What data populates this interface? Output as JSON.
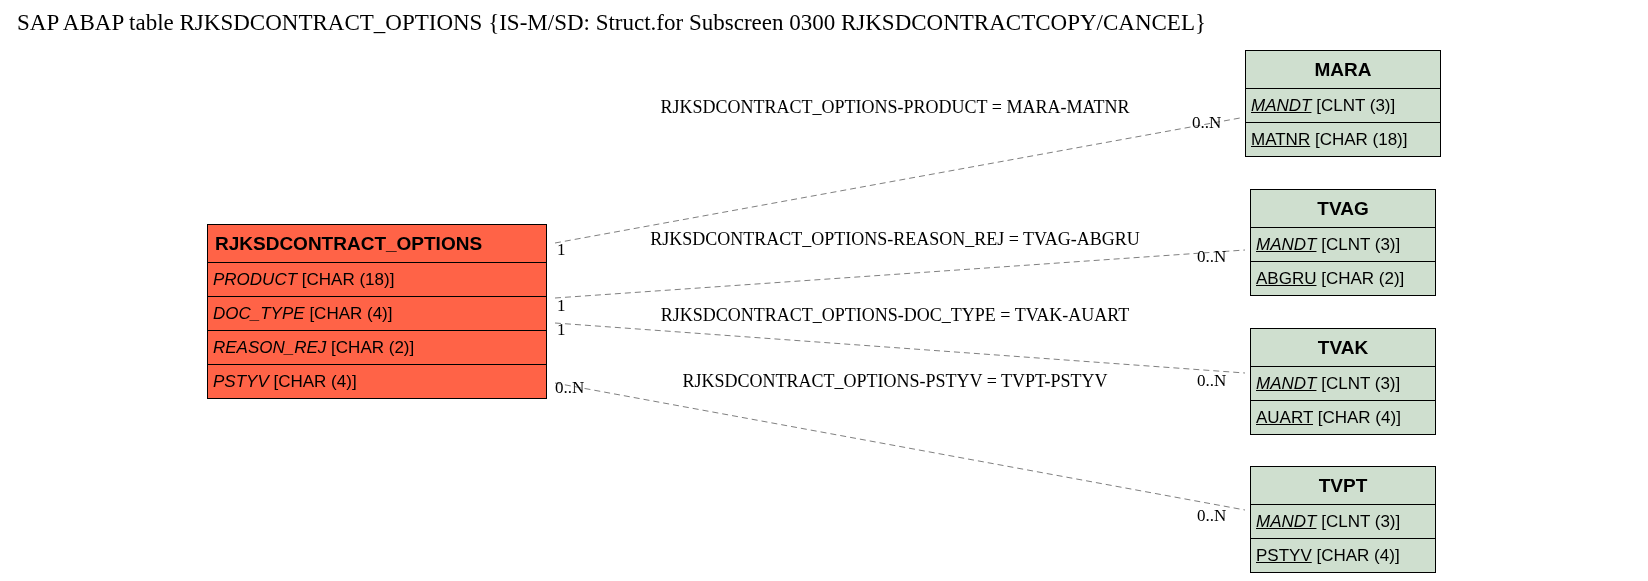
{
  "title": "SAP ABAP table RJKSDCONTRACT_OPTIONS {IS-M/SD: Struct.for Subscreen 0300 RJKSDCONTRACTCOPY/CANCEL}",
  "main_table": {
    "name": "RJKSDCONTRACT_OPTIONS",
    "fields": [
      {
        "name": "PRODUCT",
        "type": "[CHAR (18)]",
        "key": false,
        "italic": true
      },
      {
        "name": "DOC_TYPE",
        "type": "[CHAR (4)]",
        "key": false,
        "italic": true
      },
      {
        "name": "REASON_REJ",
        "type": "[CHAR (2)]",
        "key": false,
        "italic": true
      },
      {
        "name": "PSTYV",
        "type": "[CHAR (4)]",
        "key": false,
        "italic": true
      }
    ]
  },
  "related_tables": [
    {
      "name": "MARA",
      "fields": [
        {
          "name": "MANDT",
          "type": "[CLNT (3)]",
          "key": true,
          "italic": true
        },
        {
          "name": "MATNR",
          "type": "[CHAR (18)]",
          "key": true,
          "italic": false
        }
      ]
    },
    {
      "name": "TVAG",
      "fields": [
        {
          "name": "MANDT",
          "type": "[CLNT (3)]",
          "key": true,
          "italic": true
        },
        {
          "name": "ABGRU",
          "type": "[CHAR (2)]",
          "key": true,
          "italic": false
        }
      ]
    },
    {
      "name": "TVAK",
      "fields": [
        {
          "name": "MANDT",
          "type": "[CLNT (3)]",
          "key": true,
          "italic": true
        },
        {
          "name": "AUART",
          "type": "[CHAR (4)]",
          "key": true,
          "italic": false
        }
      ]
    },
    {
      "name": "TVPT",
      "fields": [
        {
          "name": "MANDT",
          "type": "[CLNT (3)]",
          "key": true,
          "italic": true
        },
        {
          "name": "PSTYV",
          "type": "[CHAR (4)]",
          "key": true,
          "italic": false
        }
      ]
    }
  ],
  "relations": [
    {
      "label": "RJKSDCONTRACT_OPTIONS-PRODUCT = MARA-MATNR",
      "from_card": "1",
      "to_card": "0..N"
    },
    {
      "label": "RJKSDCONTRACT_OPTIONS-REASON_REJ = TVAG-ABGRU",
      "from_card": "1",
      "to_card": "0..N"
    },
    {
      "label": "RJKSDCONTRACT_OPTIONS-DOC_TYPE = TVAK-AUART",
      "from_card": "1",
      "to_card": "0..N"
    },
    {
      "label": "RJKSDCONTRACT_OPTIONS-PSTYV = TVPT-PSTYV",
      "from_card": "0..N",
      "to_card": "0..N"
    }
  ]
}
